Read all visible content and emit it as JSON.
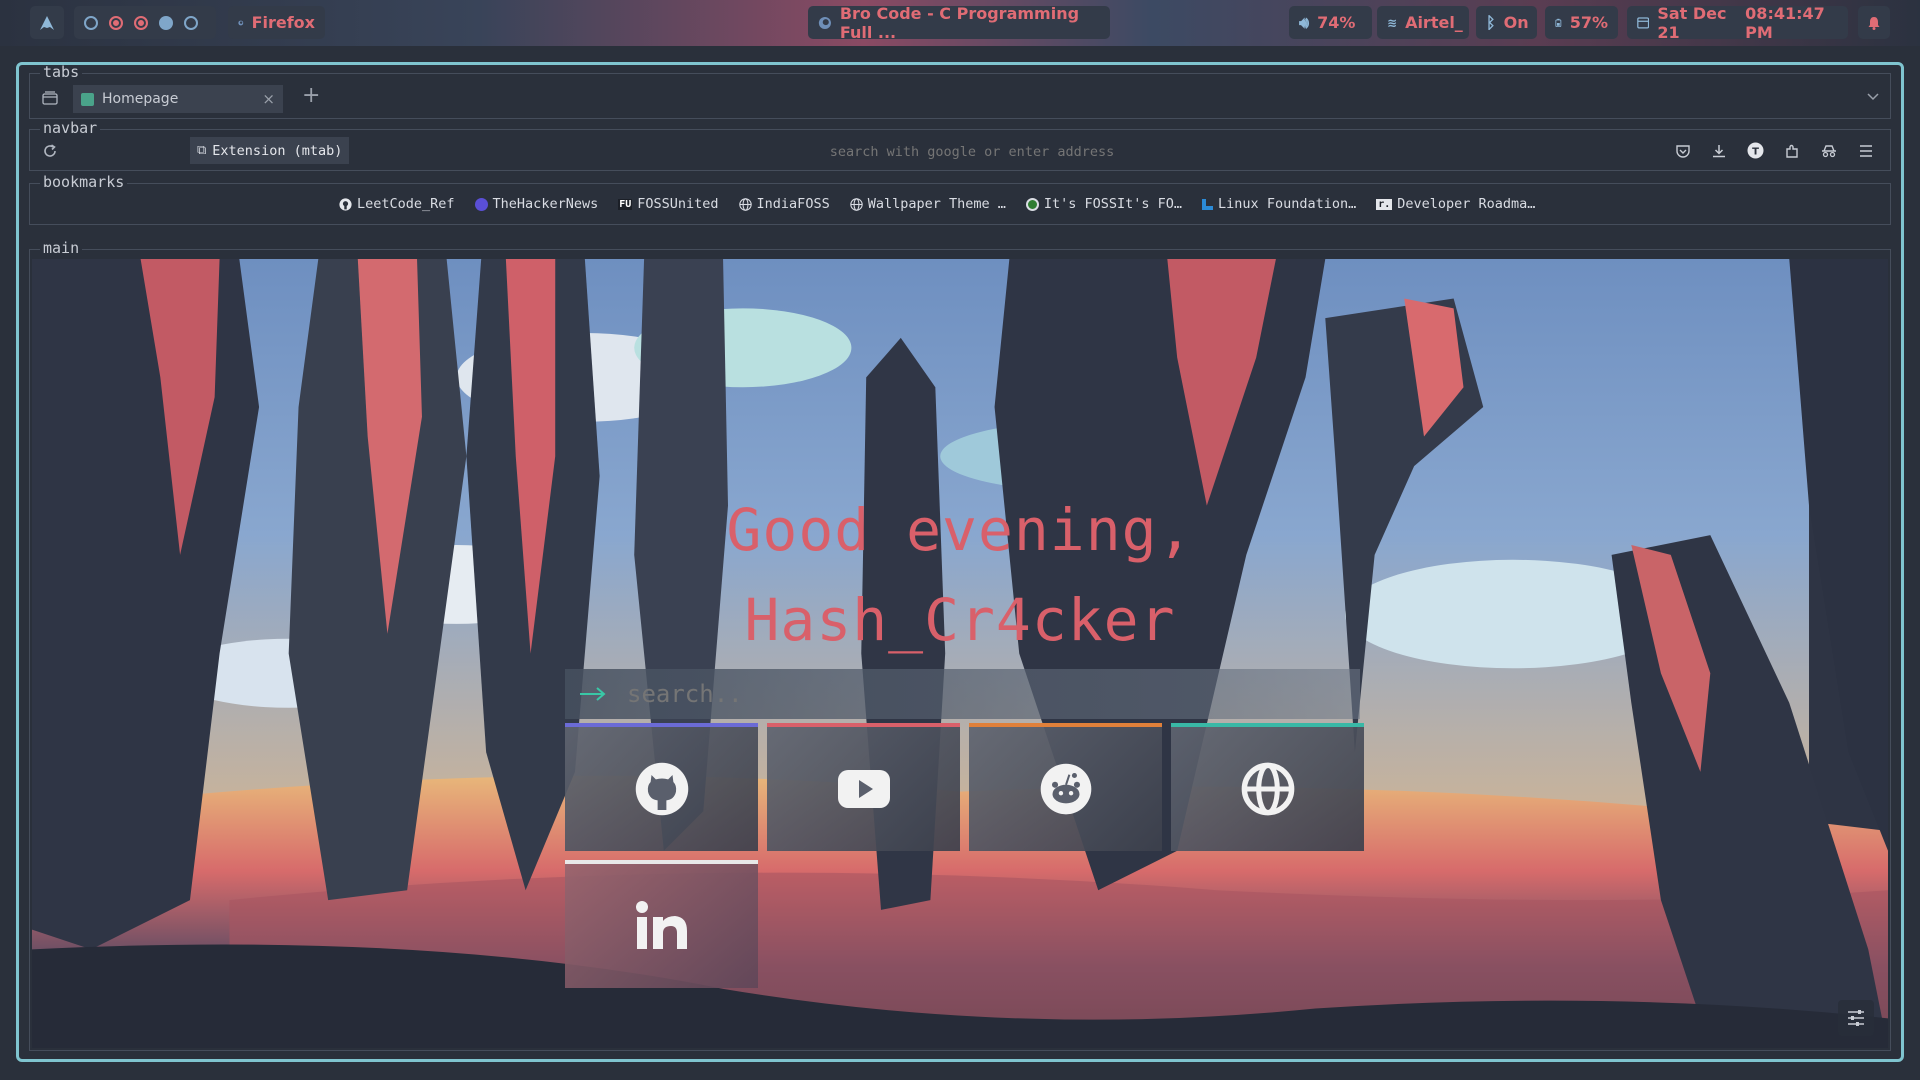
{
  "topbar": {
    "browser_label": "Firefox",
    "window_title": "Bro Code - C Programming Full ...",
    "volume": "74%",
    "wifi": "Airtel_",
    "bluetooth": "On",
    "battery": "57%",
    "date": "Sat Dec 21",
    "time": "08:41:47 PM"
  },
  "sections": {
    "tabs": "tabs",
    "navbar": "navbar",
    "bookmarks": "bookmarks",
    "main": "main"
  },
  "tabs": [
    {
      "label": "Homepage"
    }
  ],
  "navbar": {
    "extension_label": "Extension (mtab)",
    "address_placeholder": "search with google or enter address"
  },
  "bookmarks": [
    {
      "label": "LeetCode_Ref",
      "icon": "github-icon"
    },
    {
      "label": "TheHackerNews",
      "icon": "thn-icon"
    },
    {
      "label": "FOSSUnited",
      "icon": "fossunited-icon"
    },
    {
      "label": "IndiaFOSS",
      "icon": "globe-icon"
    },
    {
      "label": "Wallpaper Theme …",
      "icon": "globe-icon"
    },
    {
      "label": "It's FOSSIt's FO…",
      "icon": "itsfoss-icon"
    },
    {
      "label": "Linux Foundation…",
      "icon": "linux-foundation-icon"
    },
    {
      "label": "Developer Roadma…",
      "icon": "roadmap-icon"
    }
  ],
  "main": {
    "greeting_line1": "Good evening,",
    "greeting_line2": "Hash_Cr4cker",
    "search_placeholder": "search..",
    "quick_links": [
      {
        "icon": "github-icon",
        "accent": "#6b6bd6"
      },
      {
        "icon": "youtube-icon",
        "accent": "#d9606a"
      },
      {
        "icon": "reddit-icon",
        "accent": "#e0803a"
      },
      {
        "icon": "globe-icon",
        "accent": "#39b8a6"
      },
      {
        "icon": "linkedin-icon",
        "accent": "#e8e8e8"
      }
    ]
  },
  "colors": {
    "accent_red": "#e06c75",
    "frame_border": "#7fc4cf",
    "background": "#2a303b"
  }
}
